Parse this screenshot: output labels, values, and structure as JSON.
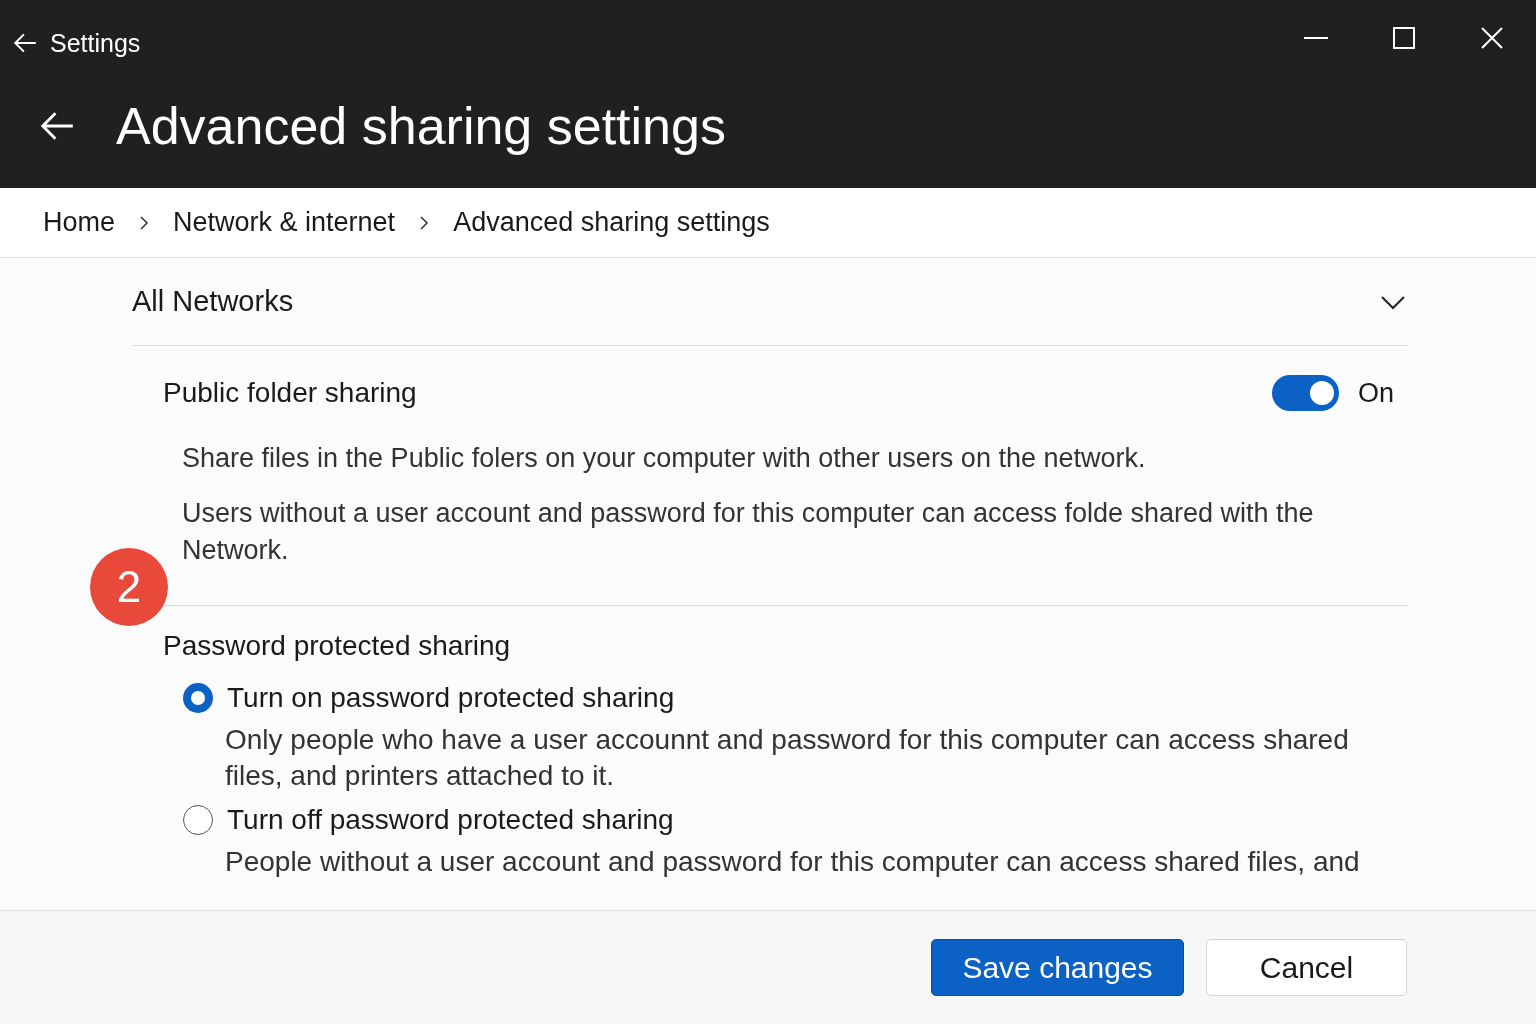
{
  "window": {
    "title": "Settings"
  },
  "header": {
    "title": "Advanced sharing settings"
  },
  "breadcrumb": [
    "Home",
    "Network & internet",
    "Advanced sharing settings"
  ],
  "section": {
    "title": "All Networks",
    "expanded": true
  },
  "public_folder": {
    "title": "Public folder sharing",
    "on": true,
    "state_label": "On",
    "descriptions": [
      "Share files in the Public folers on your computer with other users on the network.",
      "Users without a user account and password for this computer can access folde shared with the Network."
    ]
  },
  "password_sharing": {
    "title": "Password protected sharing",
    "options": [
      {
        "label": "Turn on password protected sharing",
        "description": "Only people who have a user accounnt and password for this computer can access shared files, and printers attached to it.",
        "selected": true
      },
      {
        "label": "Turn off password protected sharing",
        "description": "People without a user account and password for this computer can access shared files, and",
        "selected": false
      }
    ]
  },
  "badge": "2",
  "buttons": [
    {
      "label": "Save changes",
      "kind": "primary"
    },
    {
      "label": "Cancel",
      "kind": "secondary"
    }
  ]
}
